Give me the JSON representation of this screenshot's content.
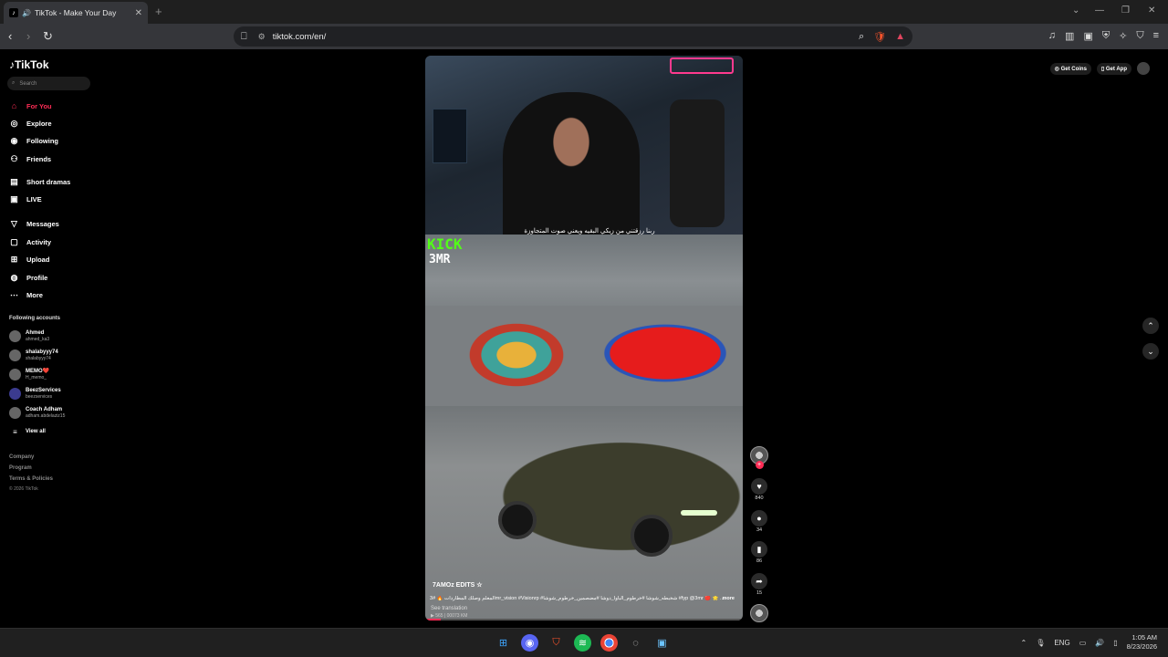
{
  "browser": {
    "tab_title": "TikTok - Make Your Day",
    "url": "tiktok.com/en/"
  },
  "sidebar": {
    "logo": "TikTok",
    "search_placeholder": "Search",
    "nav": [
      {
        "label": "For You",
        "icon": "home-icon"
      },
      {
        "label": "Explore",
        "icon": "compass-icon"
      },
      {
        "label": "Following",
        "icon": "following-icon"
      },
      {
        "label": "Friends",
        "icon": "friends-icon"
      },
      {
        "label": "Short dramas",
        "icon": "drama-icon"
      },
      {
        "label": "LIVE",
        "icon": "live-icon"
      },
      {
        "label": "Messages",
        "icon": "messages-icon"
      },
      {
        "label": "Activity",
        "icon": "activity-icon"
      },
      {
        "label": "Upload",
        "icon": "upload-icon"
      },
      {
        "label": "Profile",
        "icon": "profile-icon"
      },
      {
        "label": "More",
        "icon": "more-icon"
      }
    ],
    "following_title": "Following accounts",
    "accounts": [
      {
        "name": "Ahmed",
        "handle": "ahmed_ka3"
      },
      {
        "name": "shalabyyy74",
        "handle": "shalabyyy74"
      },
      {
        "name": "MEMO❤️",
        "handle": "H_memo_"
      },
      {
        "name": "BeezServices",
        "handle": "beezservices"
      },
      {
        "name": "Coach Adham",
        "handle": "adham.abdelaziz15"
      }
    ],
    "view_all": "View all",
    "footer": [
      "Company",
      "Program",
      "Terms & Policies",
      "© 2026 TikTok"
    ]
  },
  "video": {
    "subtitle": "ربنا رزقتني من زيكي البقيه ويعني صوت المتجاوزة",
    "kick_logo": "KICK",
    "kick_sub": "3MR",
    "author": "7AMOz EDITS ☆",
    "description": "المعلم وصلك المطاردات 🔥 #3mr_vision #Visionrp #شخبطه_شوشا #خرطوم_الباوا_دوشا #مضصمين_خرطوم_شوشا #fyp @3mr 🔴 🌟 ...",
    "more": "more",
    "see_translation": "See translation",
    "stats": "▶ 565 | 00073 KM",
    "progress": 0.05
  },
  "actions": {
    "likes": "840",
    "comments": "34",
    "saves": "86",
    "shares": "15"
  },
  "topbar": {
    "get_coins": "Get Coins",
    "get_app": "Get App"
  },
  "taskbar": {
    "lang": "ENG",
    "time": "1:05 AM",
    "date": "8/23/2026"
  }
}
